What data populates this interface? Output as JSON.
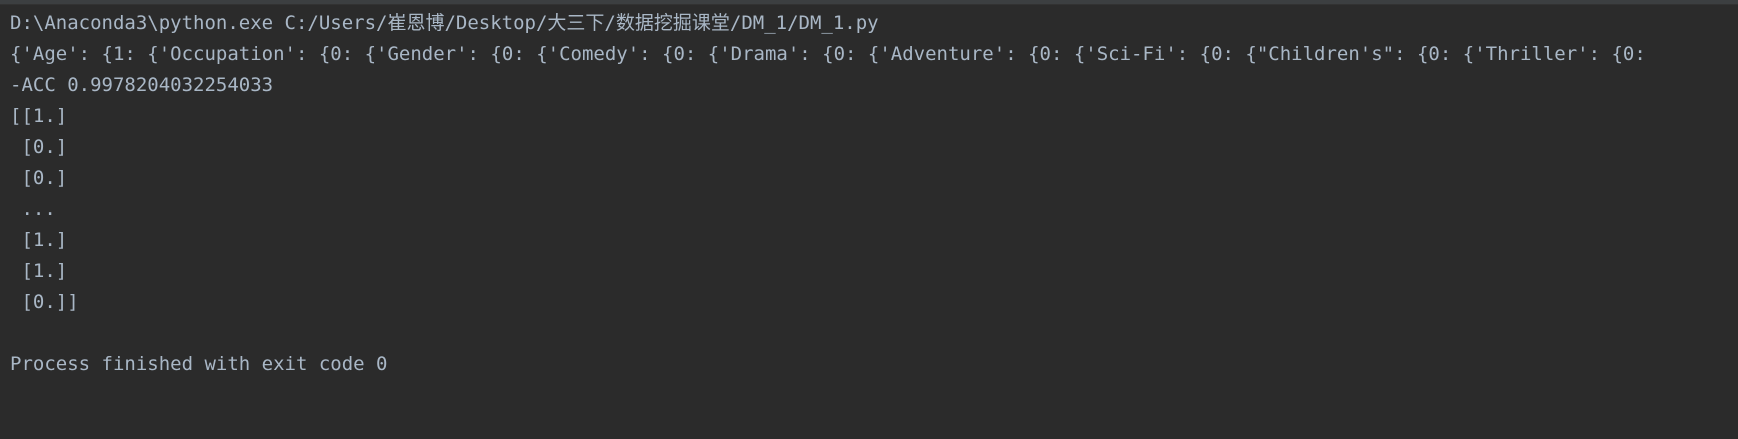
{
  "console": {
    "lines": [
      "D:\\Anaconda3\\python.exe C:/Users/崔恩博/Desktop/大三下/数据挖掘课堂/DM_1/DM_1.py",
      "{'Age': {1: {'Occupation': {0: {'Gender': {0: {'Comedy': {0: {'Drama': {0: {'Adventure': {0: {'Sci-Fi': {0: {\"Children's\": {0: {'Thriller': {0:",
      "-ACC 0.9978204032254033",
      "[[1.]",
      " [0.]",
      " [0.]",
      " ...",
      " [1.]",
      " [1.]",
      " [0.]]",
      "",
      "Process finished with exit code 0"
    ]
  }
}
